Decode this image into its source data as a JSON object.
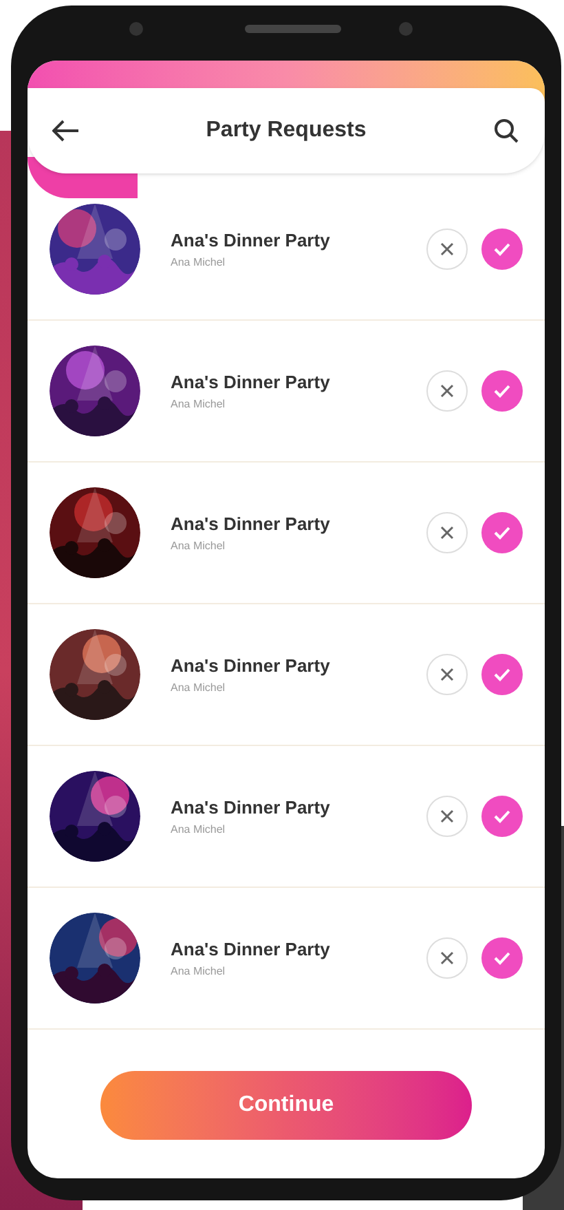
{
  "header": {
    "title": "Party Requests"
  },
  "requests": [
    {
      "title": "Ana's Dinner Party",
      "host": "Ana Michel"
    },
    {
      "title": "Ana's Dinner Party",
      "host": "Ana Michel"
    },
    {
      "title": "Ana's Dinner Party",
      "host": "Ana Michel"
    },
    {
      "title": "Ana's Dinner Party",
      "host": "Ana Michel"
    },
    {
      "title": "Ana's Dinner Party",
      "host": "Ana Michel"
    },
    {
      "title": "Ana's Dinner Party",
      "host": "Ana Michel"
    }
  ],
  "continue_button": {
    "label": "Continue"
  }
}
